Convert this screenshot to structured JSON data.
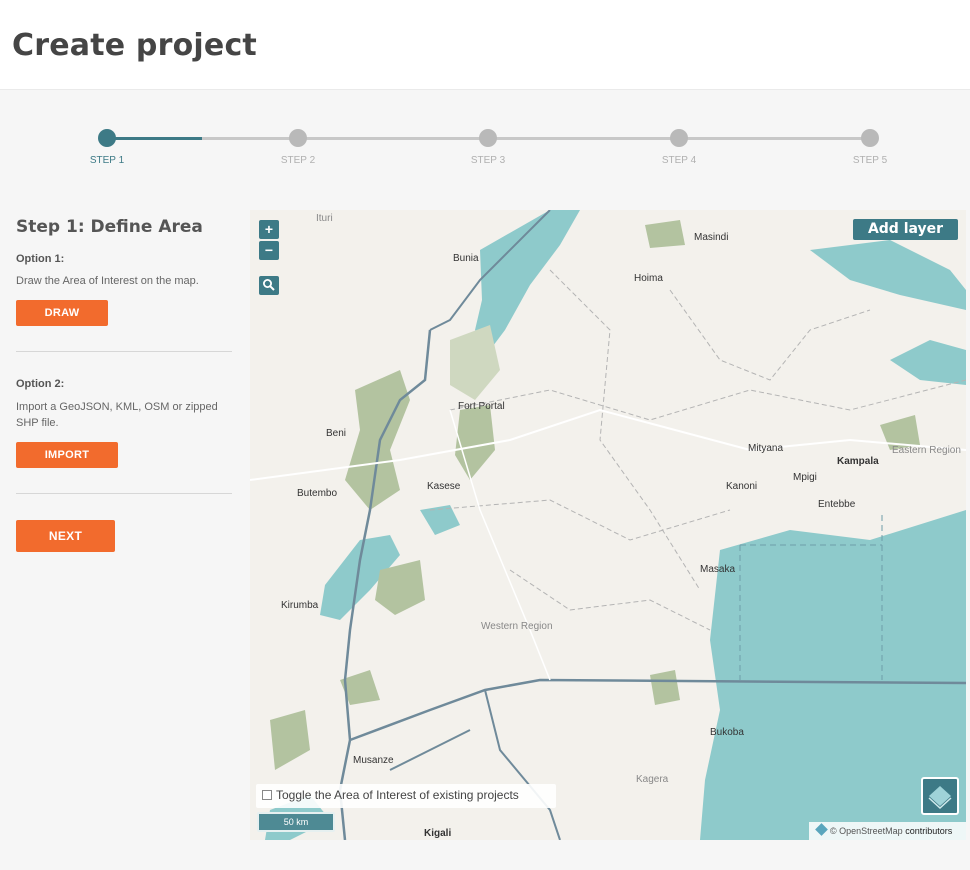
{
  "page": {
    "title": "Create project"
  },
  "stepper": {
    "steps": [
      "STEP 1",
      "STEP 2",
      "STEP 3",
      "STEP 4",
      "STEP 5"
    ],
    "active_index": 0,
    "accent": "#3d7a86"
  },
  "sidebar": {
    "heading": "Step 1: Define Area",
    "option1": {
      "title": "Option 1:",
      "text": "Draw the Area of Interest on the map.",
      "button": "DRAW"
    },
    "option2": {
      "title": "Option 2:",
      "text": "Import a GeoJSON, KML, OSM or zipped SHP file.",
      "button": "IMPORT"
    },
    "next_button": "NEXT",
    "button_color": "#f26b2d"
  },
  "map": {
    "zoom_in": "+",
    "zoom_out": "−",
    "search_icon": "magnifier-icon",
    "add_layer": "Add layer",
    "toggle_label": "Toggle the Area of Interest of existing projects",
    "scale": "50 km",
    "attribution_prefix": "© OpenStreetMap",
    "attribution_link": "contributors",
    "places": {
      "ituri": "Ituri",
      "bunia": "Bunia",
      "masindi": "Masindi",
      "hoima": "Hoima",
      "fort_portal": "Fort Portal",
      "beni": "Beni",
      "kasese": "Kasese",
      "butembo": "Butembo",
      "mityana": "Mityana",
      "kampala": "Kampala",
      "mpigi": "Mpigi",
      "kanoni": "Kanoni",
      "entebbe": "Entebbe",
      "eastern": "Eastern Region",
      "masaka": "Masaka",
      "kirumba": "Kirumba",
      "western": "Western Region",
      "bukoba": "Bukoba",
      "musanze": "Musanze",
      "kagera": "Kagera",
      "kigali": "Kigali"
    }
  }
}
